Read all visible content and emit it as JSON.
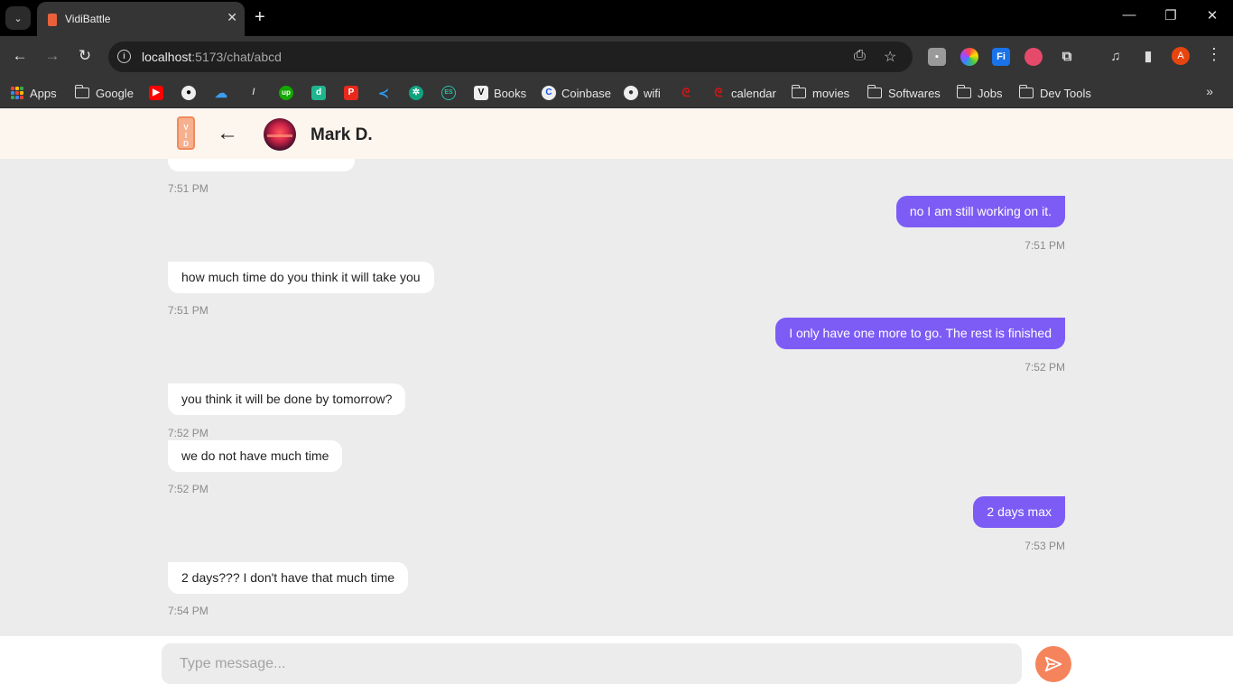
{
  "browser": {
    "tab_title": "VidiBattle",
    "url_host": "localhost",
    "url_path": ":5173/chat/abcd",
    "bookmarks": [
      {
        "label": "Apps"
      },
      {
        "label": "Google"
      },
      {
        "label": "Books"
      },
      {
        "label": "Coinbase"
      },
      {
        "label": "wifi"
      },
      {
        "label": "calendar"
      },
      {
        "label": "movies"
      },
      {
        "label": "Softwares"
      },
      {
        "label": "Jobs"
      },
      {
        "label": "Dev Tools"
      }
    ],
    "profile_initial": "A"
  },
  "chat": {
    "contact_name": "Mark D.",
    "messages": [
      {
        "side": "out",
        "text": "no I am still working on it.",
        "time": "7:51 PM"
      },
      {
        "side": "in",
        "text": "how much time do you think it will take you",
        "time": "7:51 PM"
      },
      {
        "side": "out",
        "text": "I only have one more to go. The rest is finished",
        "time": "7:52 PM"
      },
      {
        "side": "in",
        "text": "you think it will be done by tomorrow?",
        "time": "7:52 PM"
      },
      {
        "side": "in",
        "text": "we do not have much time",
        "time": "7:52 PM"
      },
      {
        "side": "out",
        "text": "2 days max",
        "time": "7:53 PM"
      },
      {
        "side": "in",
        "text": "2 days??? I don't have that much time",
        "time": "7:54 PM"
      }
    ],
    "partial_top_time": "7:51 PM"
  },
  "composer": {
    "placeholder": "Type message..."
  },
  "colors": {
    "outgoing_bubble": "#7c5cf5",
    "incoming_bubble": "#ffffff",
    "send_button": "#f5845d",
    "header_bg": "#fdf6ef"
  }
}
